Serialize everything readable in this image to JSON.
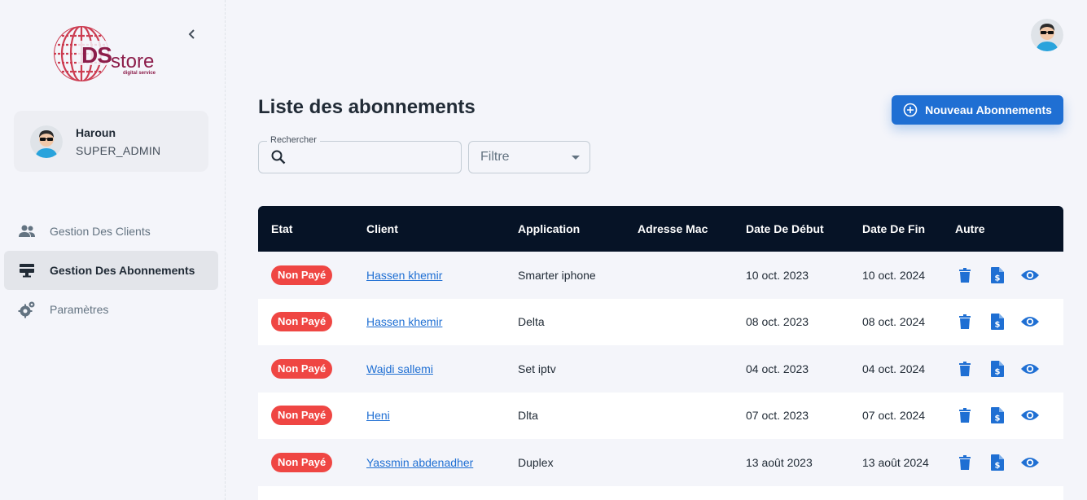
{
  "brand": {
    "name_ds": "DS",
    "name_store": "store",
    "tagline": "digital service"
  },
  "user": {
    "name": "Haroun",
    "role": "SUPER_ADMIN"
  },
  "nav": [
    {
      "label": "Gestion Des Clients",
      "icon": "people-icon",
      "active": false
    },
    {
      "label": "Gestion Des Abonnements",
      "icon": "desktop-icon",
      "active": true
    },
    {
      "label": "Paramètres",
      "icon": "gear-icon",
      "active": false
    }
  ],
  "page": {
    "title": "Liste des abonnements",
    "new_button": "Nouveau Abonnements",
    "search_label": "Rechercher",
    "search_value": "",
    "filter_label": "Filtre"
  },
  "table": {
    "headers": [
      "Etat",
      "Client",
      "Application",
      "Adresse Mac",
      "Date De Début",
      "Date De Fin",
      "Autre"
    ],
    "rows": [
      {
        "etat": "Non Payé",
        "client": "Hassen khemir",
        "application": "Smarter iphone",
        "mac": "",
        "start": "10 oct. 2023",
        "end": "10 oct. 2024"
      },
      {
        "etat": "Non Payé",
        "client": "Hassen khemir",
        "application": "Delta",
        "mac": "",
        "start": "08 oct. 2023",
        "end": "08 oct. 2024"
      },
      {
        "etat": "Non Payé",
        "client": "Wajdi sallemi",
        "application": "Set iptv",
        "mac": "",
        "start": "04 oct. 2023",
        "end": "04 oct. 2024"
      },
      {
        "etat": "Non Payé",
        "client": "Heni",
        "application": "Dlta",
        "mac": "",
        "start": "07 oct. 2023",
        "end": "07 oct. 2024"
      },
      {
        "etat": "Non Payé",
        "client": "Yassmin abdenadher",
        "application": "Duplex",
        "mac": "",
        "start": "13 août 2023",
        "end": "13 août 2024"
      }
    ]
  },
  "colors": {
    "accent": "#1f6fd3",
    "header_bg": "#061326",
    "badge_unpaid": "#ef4643",
    "brand": "#8c1d4a"
  }
}
